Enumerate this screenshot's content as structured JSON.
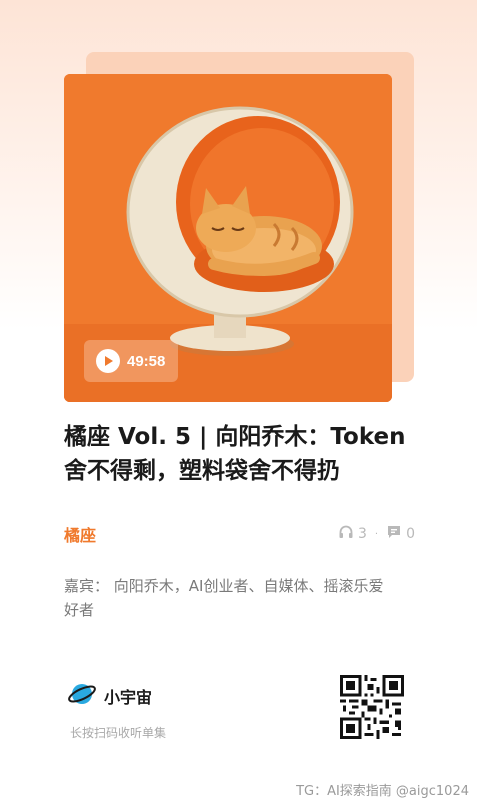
{
  "episode": {
    "title": "橘座 Vol. 5 | 向阳乔木：Token舍不得剩，塑料袋舍不得扔",
    "duration": "49:58",
    "cover_bg_color": "#f07a2d"
  },
  "podcast": {
    "name": "橘座"
  },
  "stats": {
    "listeners": "3",
    "comments": "0",
    "separator": "·"
  },
  "guests_text": "嘉宾： 向阳乔木，AI创业者、自媒体、摇滚乐爱好者",
  "footer": {
    "brand_name": "小宇宙",
    "scan_hint": "长按扫码收听单集"
  },
  "watermark": "TG：AI探索指南 @aigc1024",
  "icons": {
    "play": "play-icon",
    "headphones": "headphones-icon",
    "comment": "comment-icon",
    "planet_logo": "planet-logo-icon",
    "qr": "qr-code"
  },
  "colors": {
    "accent": "#f07a2d",
    "text": "#1a1a1a",
    "muted": "#7a7a7a"
  }
}
